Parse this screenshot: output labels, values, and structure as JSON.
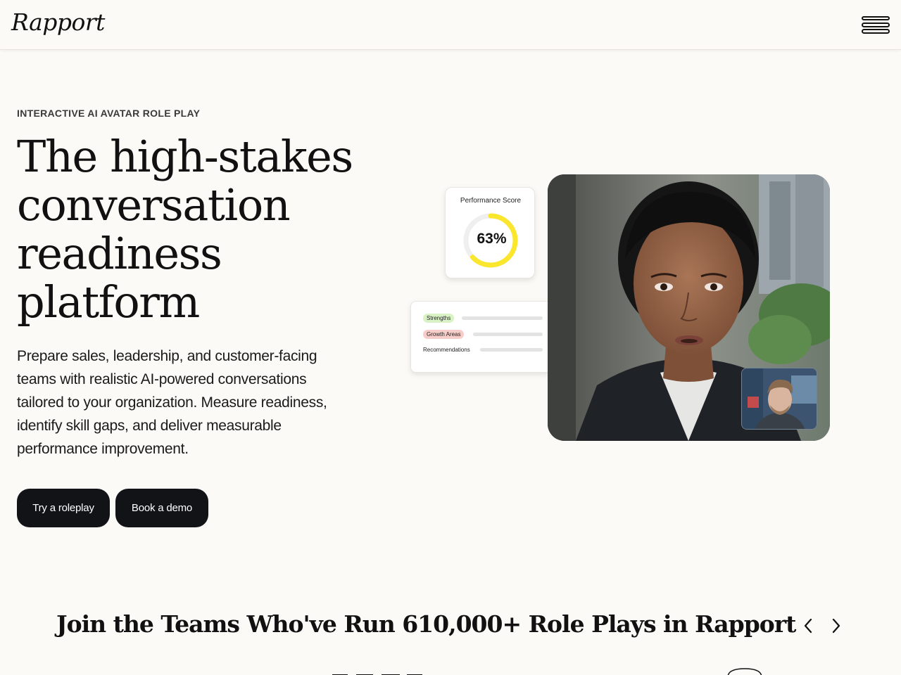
{
  "header": {
    "logo_text": "Rapport",
    "menu_icon": "hamburger-menu-icon"
  },
  "hero": {
    "eyebrow": "INTERACTIVE AI AVATAR ROLE PLAY",
    "title_lines": [
      "The high-stakes",
      "conversation",
      "readiness",
      "platform"
    ],
    "description": "Prepare sales, leadership, and customer-facing teams with realistic AI-powered conversations tailored to your organization. Measure readiness, identify skill gaps, and deliver measurable performance improvement.",
    "primary_button": "Try a roleplay",
    "secondary_button": "Book a demo"
  },
  "score_card": {
    "title": "Performance Score",
    "value_text": "63%",
    "value_fraction": 0.63,
    "ring_color": "#FBE62E",
    "track_color": "#EFEFEF"
  },
  "feedback_card": {
    "items": [
      {
        "label": "Strengths",
        "color": "#D8F2C6"
      },
      {
        "label": "Growth Areas",
        "color": "#F7CDC9"
      },
      {
        "label": "Recommendations",
        "color": ""
      }
    ]
  },
  "video": {
    "main_feed": "ai-avatar-video-feed",
    "self_view": "user-webcam-feed"
  },
  "social_proof": {
    "title": "Join the Teams Who've Run 610,000+ Role Plays in Rapport",
    "prev_icon": "chevron-left-icon",
    "next_icon": "chevron-right-icon"
  },
  "colors": {
    "background": "#FCFAF6",
    "button_bg": "#111317",
    "text": "#111111"
  }
}
